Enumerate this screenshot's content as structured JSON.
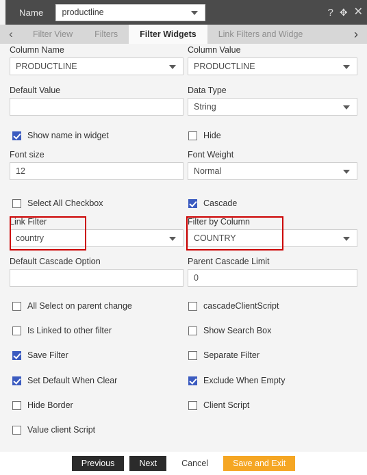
{
  "titlebar": {
    "name_label": "Name",
    "name_value": "productline",
    "help_icon": "question-mark-icon",
    "move_icon": "move-arrows-icon",
    "close_icon": "close-x-icon",
    "help_glyph": "?",
    "move_glyph": "✥",
    "close_glyph": "✕"
  },
  "tabs": {
    "prev_glyph": "‹",
    "next_glyph": "›",
    "items": [
      {
        "label": "Filter View",
        "active": false
      },
      {
        "label": "Filters",
        "active": false
      },
      {
        "label": "Filter Widgets",
        "active": true
      },
      {
        "label": "Link Filters and Widge",
        "active": false
      }
    ]
  },
  "form": {
    "column_name": {
      "label": "Column Name",
      "value": "PRODUCTLINE"
    },
    "column_value": {
      "label": "Column Value",
      "value": "PRODUCTLINE"
    },
    "default_value": {
      "label": "Default Value",
      "value": ""
    },
    "data_type": {
      "label": "Data Type",
      "value": "String"
    },
    "font_size": {
      "label": "Font size",
      "value": "12"
    },
    "font_weight": {
      "label": "Font Weight",
      "value": "Normal"
    },
    "link_filter": {
      "label": "Link Filter",
      "value": "country"
    },
    "filter_by_column": {
      "label": "Filter by Column",
      "value": "COUNTRY"
    },
    "default_cascade_option": {
      "label": "Default Cascade Option",
      "value": ""
    },
    "parent_cascade_limit": {
      "label": "Parent Cascade Limit",
      "value": "0"
    }
  },
  "checkboxes": {
    "show_name_in_widget": {
      "label": "Show name in widget",
      "checked": true
    },
    "hide": {
      "label": "Hide",
      "checked": false
    },
    "select_all_checkbox": {
      "label": "Select All Checkbox",
      "checked": false
    },
    "cascade": {
      "label": "Cascade",
      "checked": true
    },
    "all_select_on_parent_change": {
      "label": "All Select on parent change",
      "checked": false
    },
    "cascade_client_script": {
      "label": "cascadeClientScript",
      "checked": false
    },
    "is_linked_to_other_filter": {
      "label": "Is Linked to other filter",
      "checked": false
    },
    "show_search_box": {
      "label": "Show Search Box",
      "checked": false
    },
    "save_filter": {
      "label": "Save Filter",
      "checked": true
    },
    "separate_filter": {
      "label": "Separate Filter",
      "checked": false
    },
    "set_default_when_clear": {
      "label": "Set Default When Clear",
      "checked": true
    },
    "exclude_when_empty": {
      "label": "Exclude When Empty",
      "checked": true
    },
    "hide_border": {
      "label": "Hide Border",
      "checked": false
    },
    "client_script": {
      "label": "Client Script",
      "checked": false
    },
    "value_client_script": {
      "label": "Value client Script",
      "checked": false
    }
  },
  "footer": {
    "previous": "Previous",
    "next": "Next",
    "cancel": "Cancel",
    "save_and_exit": "Save and Exit"
  },
  "colors": {
    "titlebar_bg": "#4b4b4b",
    "tabstrip_bg": "#d7d7d7",
    "active_tab_bg": "#fafafa",
    "form_bg": "#f4f4f4",
    "checkbox_checked": "#3b5bc0",
    "annotation_red": "#cc0000",
    "accent_button": "#f5a623",
    "dark_button": "#2b2b2b"
  }
}
